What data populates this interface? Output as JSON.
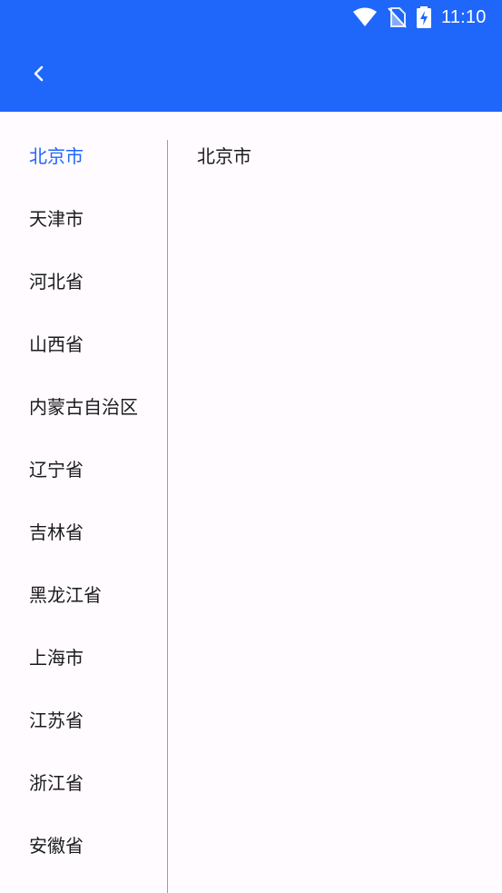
{
  "status_bar": {
    "time": "11:10",
    "icons": [
      "wifi-icon",
      "no-sim-icon",
      "battery-charging-icon"
    ]
  },
  "toolbar": {
    "back_icon": "chevron-left-icon"
  },
  "colors": {
    "accent": "#1f66fb",
    "background": "#fffbfe",
    "text": "#1b1b1f",
    "divider": "#9e9e9e"
  },
  "provinces": [
    {
      "label": "北京市",
      "selected": true
    },
    {
      "label": "天津市",
      "selected": false
    },
    {
      "label": "河北省",
      "selected": false
    },
    {
      "label": "山西省",
      "selected": false
    },
    {
      "label": "内蒙古自治区",
      "selected": false
    },
    {
      "label": "辽宁省",
      "selected": false
    },
    {
      "label": "吉林省",
      "selected": false
    },
    {
      "label": "黑龙江省",
      "selected": false
    },
    {
      "label": "上海市",
      "selected": false
    },
    {
      "label": "江苏省",
      "selected": false
    },
    {
      "label": "浙江省",
      "selected": false
    },
    {
      "label": "安徽省",
      "selected": false
    }
  ],
  "cities": [
    {
      "label": "北京市"
    }
  ]
}
